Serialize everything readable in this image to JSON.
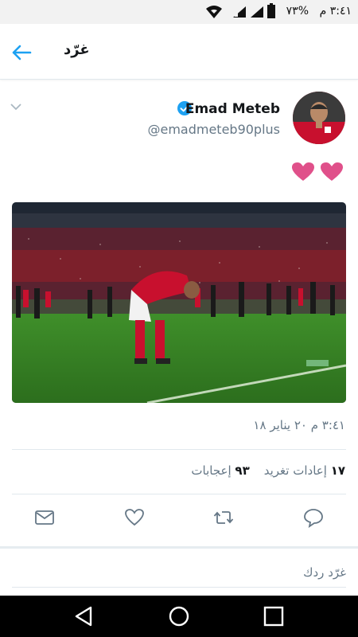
{
  "status_bar": {
    "time": "٣:٤١ م",
    "battery": "%٧٣"
  },
  "header": {
    "title": "غرّد"
  },
  "tweet": {
    "display_name": "Emad Meteb",
    "handle": "@emadmeteb90plus",
    "timestamp": "٣:٤١ م ٢٠ يناير ١٨",
    "retweets_count": "١٧",
    "retweets_label": "إعادات تغريد",
    "likes_count": "٩٣",
    "likes_label": "إعجابات"
  },
  "reply": {
    "placeholder": "غرّد ردك"
  },
  "colors": {
    "accent": "#1da1f2",
    "heart": "#e0508a",
    "text_secondary": "#657786"
  },
  "icons": [
    "wifi-icon",
    "signal-icon",
    "battery-icon",
    "back-arrow-icon",
    "chevron-down-icon",
    "verified-icon",
    "heart-icon",
    "mail-icon",
    "like-icon",
    "retweet-icon",
    "reply-icon",
    "nav-back-icon",
    "nav-home-icon",
    "nav-recents-icon"
  ]
}
